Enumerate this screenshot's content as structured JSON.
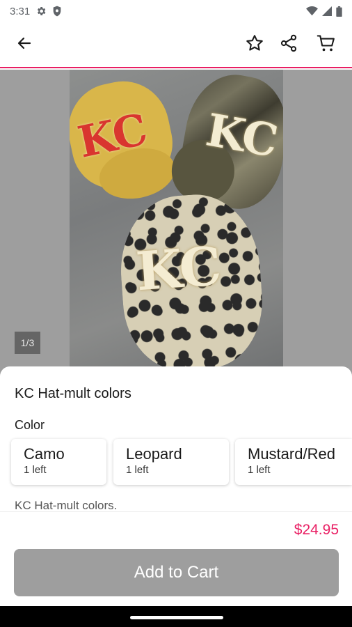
{
  "status_bar": {
    "time": "3:31",
    "icons": [
      "gear-icon",
      "shield-icon",
      "wifi-icon",
      "signal-icon",
      "battery-icon"
    ]
  },
  "app_bar": {
    "icons": [
      "arrow-back-icon",
      "star-outline-icon",
      "share-icon",
      "cart-icon"
    ]
  },
  "gallery": {
    "counter": "1/3",
    "image_text": "KC"
  },
  "product": {
    "title": "KC  Hat-mult colors",
    "color_label": "Color",
    "options": [
      {
        "name": "Camo",
        "stock": "1 left"
      },
      {
        "name": "Leopard",
        "stock": "1 left"
      },
      {
        "name": "Mustard/Red",
        "stock": "1 left"
      }
    ],
    "description": "KC  Hat-mult colors."
  },
  "footer": {
    "price": "$24.95",
    "add_to_cart_label": "Add to Cart"
  },
  "colors": {
    "accent": "#e91e63",
    "button_disabled": "#9e9e9e"
  }
}
